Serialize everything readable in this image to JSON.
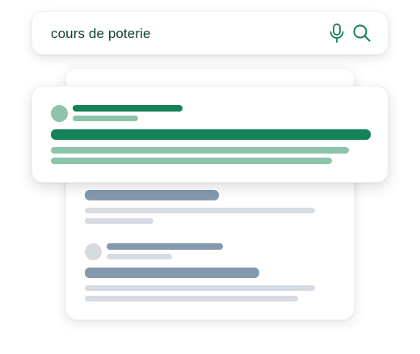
{
  "search": {
    "query": "cours de poterie"
  },
  "icons": {
    "mic": "microphone-icon",
    "search": "search-icon"
  },
  "colors": {
    "brand_green": "#138256",
    "query_text": "#0c3f2e",
    "light_green": "#8cc4aa",
    "favicon_green": "#8fc3ab",
    "slate": "#8599ad",
    "slate_light": "#d6dce2",
    "favicon_gray": "#d5dbe1"
  }
}
